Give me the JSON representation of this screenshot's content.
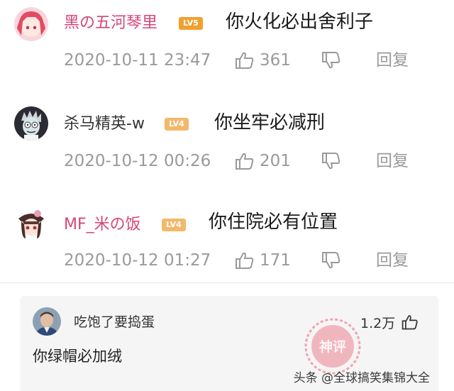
{
  "comments": [
    {
      "username": "黑の五河琴里",
      "level_badge": "LV5",
      "text": "你火化必出舍利子",
      "timestamp": "2020-10-11 23:47",
      "likes": "361",
      "reply_label": "回复",
      "username_color": "#d6457a",
      "badge_color": "#f0a030"
    },
    {
      "username": "杀马精英-w",
      "level_badge": "LV4",
      "text": "你坐牢必减刑",
      "timestamp": "2020-10-12 00:26",
      "likes": "201",
      "reply_label": "回复",
      "username_color": "#333333",
      "badge_color": "#f2b96a"
    },
    {
      "username": "MF_米の饭",
      "level_badge": "LV4",
      "text": "你住院必有位置",
      "timestamp": "2020-10-12 01:27",
      "likes": "171",
      "reply_label": "回复",
      "username_color": "#d6457a",
      "badge_color": "#f2b96a"
    }
  ],
  "hot_reply": {
    "username": "吃饱了要捣蛋",
    "likes": "1.2万",
    "text": "你绿帽必加绒",
    "stamp_label": "神评"
  },
  "watermark": "头条 @全球搞笑集锦大全",
  "icons": {
    "like": "thumbs-up-icon",
    "dislike": "thumbs-down-icon"
  },
  "colors": {
    "meta_gray": "#9a9a9a",
    "stamp_red": "#e8435a",
    "card_bg": "#f5f5f5"
  }
}
